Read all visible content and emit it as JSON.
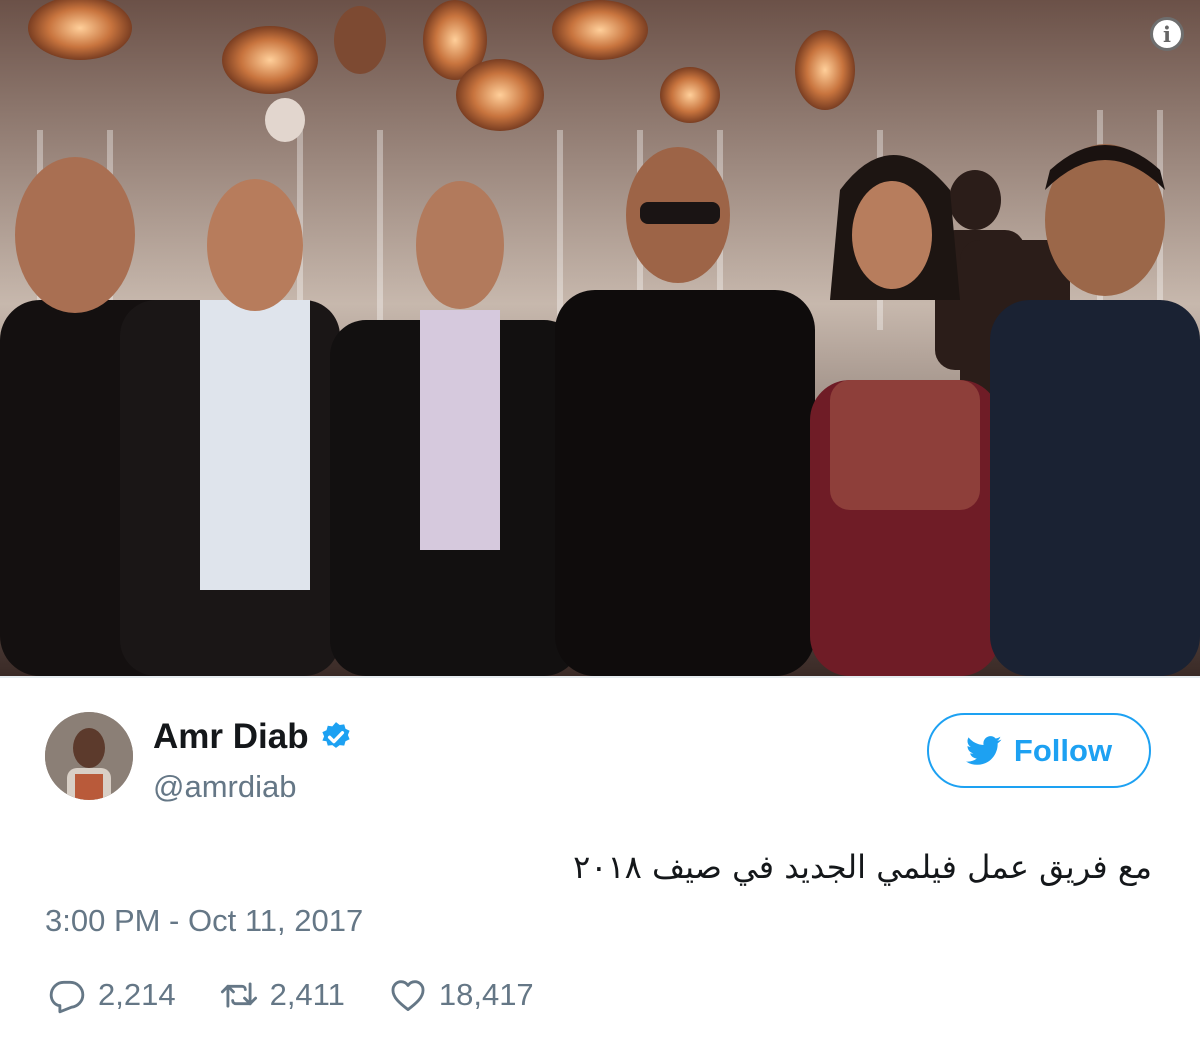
{
  "tweet": {
    "user": {
      "name": "Amr Diab",
      "handle": "@amrdiab",
      "verified": true
    },
    "follow_label": "Follow",
    "text": "مع فريق عمل فيلمي الجديد في صيف ٢٠١٨",
    "timestamp": "3:00 PM - Oct 11, 2017",
    "stats": {
      "replies": "2,214",
      "retweets": "2,411",
      "likes": "18,417"
    }
  },
  "icons": {
    "info": "info-icon",
    "verified": "verified-badge-icon",
    "follow": "twitter-bird-icon",
    "reply": "reply-icon",
    "retweet": "retweet-icon",
    "like": "heart-icon"
  },
  "colors": {
    "accent": "#1da1f2",
    "secondary_text": "#657786",
    "primary_text": "#14171a"
  }
}
